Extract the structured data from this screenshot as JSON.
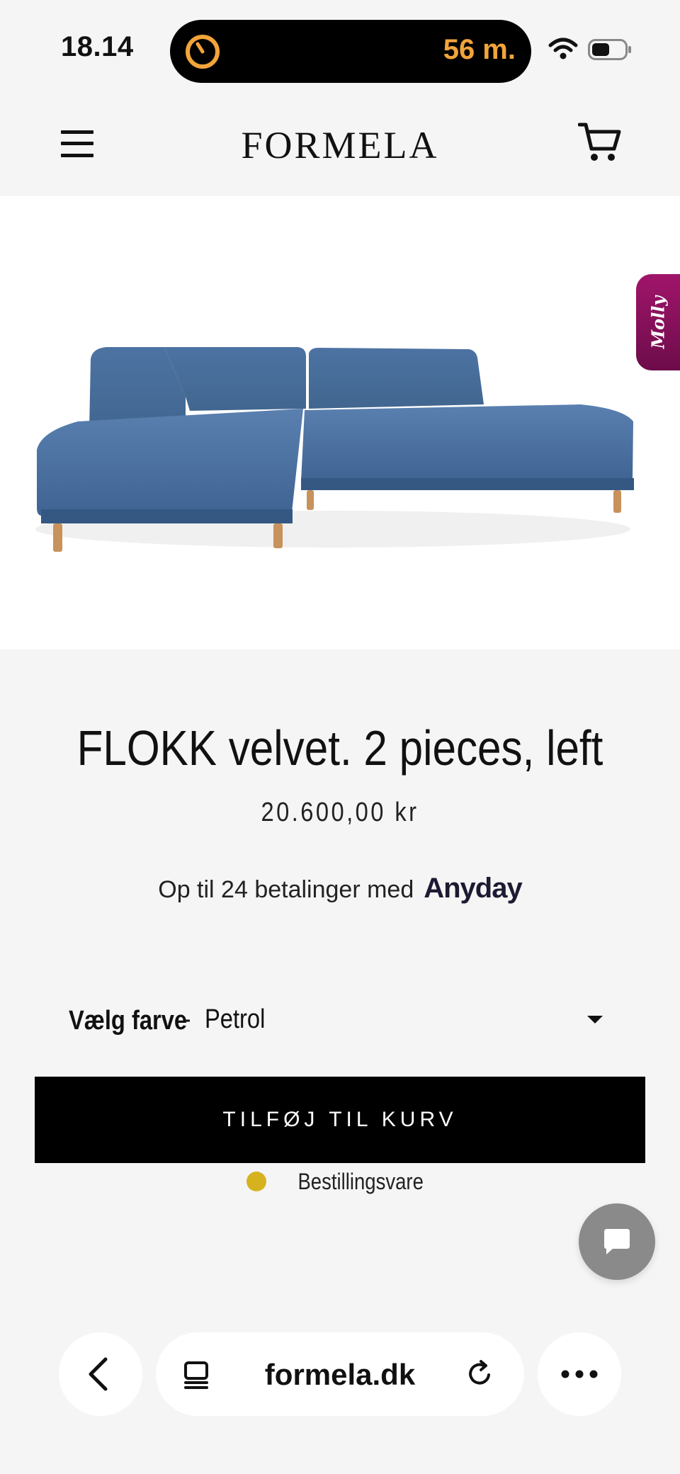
{
  "status_bar": {
    "time": "18.14",
    "activity_text": "56 m.",
    "accent_color": "#f2a43a"
  },
  "header": {
    "logo": "FORMELA",
    "icons": [
      "menu-icon",
      "cart-icon"
    ]
  },
  "product": {
    "image_alt": "Blue velvet corner sofa",
    "title": "FLOKK velvet. 2 pieces, left",
    "price": "20.600,00 kr",
    "installments_text": "Op til 24 betalinger med",
    "installments_provider": "Anyday",
    "variant": {
      "label": "Vælg farve",
      "separator": "-",
      "selected": "Petrol"
    },
    "add_to_cart_label": "TILFØJ TIL KURV",
    "stock_status": "Bestillingsvare",
    "stock_color": "#d6b21f",
    "sofa_color": "#4a6f9e"
  },
  "widgets": {
    "molly_label": "Molly",
    "chat_icon": "chat-bubble-icon"
  },
  "browser": {
    "url": "formela.dk",
    "icons": [
      "back-icon",
      "tabs-icon",
      "reload-icon",
      "more-icon"
    ]
  }
}
